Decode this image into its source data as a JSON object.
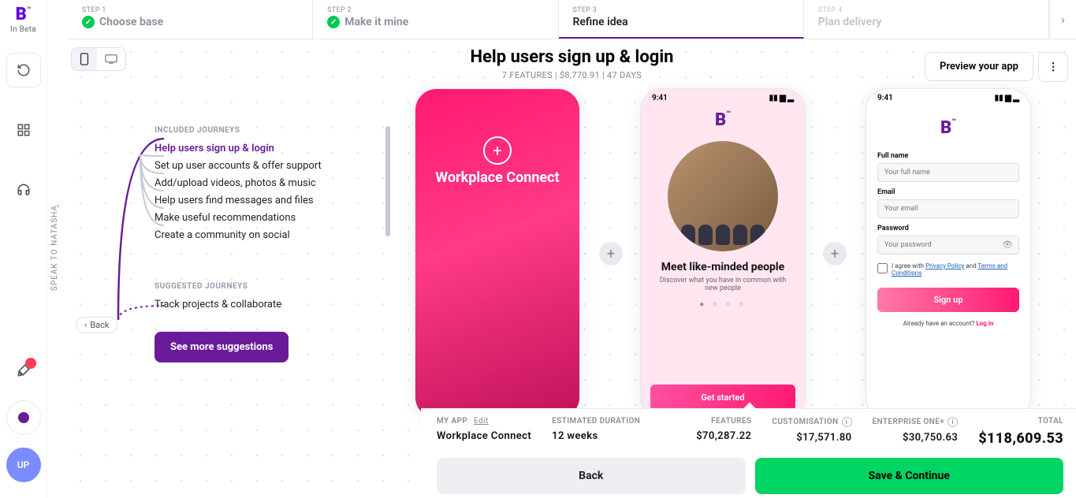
{
  "brand": {
    "logo": "B",
    "tm": "™",
    "sub": "In Beta"
  },
  "speak_label": "SPEAK TO NATASHA",
  "avatar": "UP",
  "steps": [
    {
      "num": "STEP 1",
      "label": "Choose base"
    },
    {
      "num": "STEP 2",
      "label": "Make it mine"
    },
    {
      "num": "STEP 3",
      "label": "Refine idea"
    },
    {
      "num": "STEP 4",
      "label": "Plan delivery"
    }
  ],
  "header": {
    "title": "Help users sign up & login",
    "sub": "7 FEATURES | $8,770.91 | 47 DAYS",
    "preview": "Preview your app"
  },
  "back_pill": "Back",
  "journeys": {
    "included_heading": "INCLUDED JOURNEYS",
    "items": [
      "Help users sign up & login",
      "Set up user accounts & offer support",
      "Add/upload videos, photos & music",
      "Help users find messages and files",
      "Make useful recommendations",
      "Create a community on social"
    ],
    "suggested_heading": "SUGGESTED JOURNEYS",
    "suggested": [
      "Track projects & collaborate"
    ],
    "see_more": "See more suggestions"
  },
  "phones": {
    "p1_title": "Workplace Connect",
    "time": "9:41",
    "p2": {
      "heading": "Meet like-minded people",
      "desc": "Discover what you have in common with new people",
      "cta": "Get started"
    },
    "p3": {
      "full_name_label": "Full name",
      "full_name_ph": "Your full name",
      "email_label": "Email",
      "email_ph": "Your email",
      "password_label": "Password",
      "password_ph": "Your password",
      "agree_prefix": "I agree with ",
      "privacy": "Privacy Policy",
      "and": " and ",
      "terms": "Terms and Conditions",
      "cta": "Sign up",
      "already": "Already have an account?  ",
      "login": "Log in"
    }
  },
  "bottom": {
    "myapp_label": "MY APP",
    "edit": "Edit",
    "myapp_val": "Workplace Connect",
    "duration_label": "ESTIMATED DURATION",
    "duration_val": "12 weeks",
    "features_label": "FEATURES",
    "features_val": "$70,287.22",
    "custom_label": "CUSTOMISATION",
    "custom_val": "$17,571.80",
    "ent_label": "ENTERPRISE ONE+",
    "ent_val": "$30,750.63",
    "total_label": "TOTAL",
    "total_val": "$118,609.53",
    "back": "Back",
    "save": "Save & Continue"
  }
}
